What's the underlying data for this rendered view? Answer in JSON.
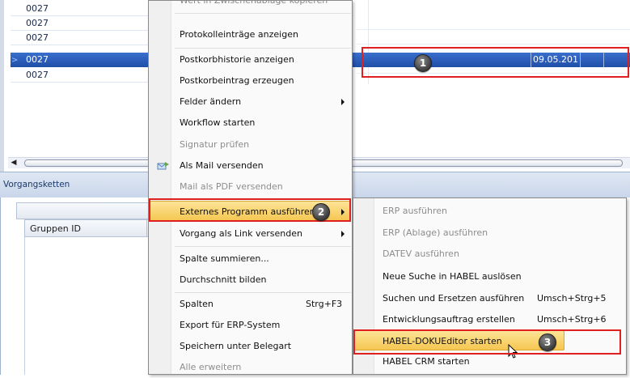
{
  "grid": {
    "rows": [
      {
        "id": "0027",
        "selected": false
      },
      {
        "id": "0027",
        "selected": false
      },
      {
        "id": "0027",
        "selected": false
      },
      {
        "id": "0027",
        "selected": true
      },
      {
        "id": "0027",
        "selected": false
      }
    ],
    "selected_date": "09.05.201",
    "scroll_left_arrow": "◀"
  },
  "panel": {
    "title": "Vorgangsketten",
    "column_header": "Gruppen ID"
  },
  "context_menu": {
    "items": [
      {
        "label": "Wert in Zwischenablage kopieren",
        "disabled": false
      },
      {
        "label": "Protokolleinträge anzeigen",
        "disabled": false
      },
      {
        "label": "Postkorbhistorie anzeigen",
        "disabled": false
      },
      {
        "label": "Postkorbeintrag erzeugen",
        "disabled": false
      },
      {
        "label": "Felder ändern",
        "disabled": false,
        "submenu": true
      },
      {
        "label": "Workflow starten",
        "disabled": false
      },
      {
        "label": "Signatur prüfen",
        "disabled": true
      },
      {
        "label": "Als Mail versenden",
        "disabled": false,
        "icon": "mail-icon"
      },
      {
        "label": "Mail als PDF versenden",
        "disabled": true
      },
      {
        "label": "Externes Programm ausführen",
        "disabled": false,
        "submenu": true,
        "highlighted": true
      },
      {
        "label": "Vorgang als Link versenden",
        "disabled": false,
        "submenu": true
      },
      {
        "label": "Spalte summieren...",
        "disabled": false
      },
      {
        "label": "Durchschnitt bilden",
        "disabled": false
      },
      {
        "label": "Spalten",
        "disabled": false,
        "shortcut": "Strg+F3"
      },
      {
        "label": "Export für ERP-System",
        "disabled": false
      },
      {
        "label": "Speichern unter Belegart",
        "disabled": false
      },
      {
        "label": "Alle erweitern",
        "disabled": true
      }
    ]
  },
  "submenu": {
    "items": [
      {
        "label": "ERP ausführen",
        "disabled": true
      },
      {
        "label": "ERP (Ablage) ausführen",
        "disabled": true
      },
      {
        "label": "DATEV ausführen",
        "disabled": true
      },
      {
        "label": "Neue Suche in HABEL auslösen",
        "disabled": false
      },
      {
        "label": "Suchen und Ersetzen ausführen",
        "disabled": false,
        "shortcut": "Umsch+Strg+5"
      },
      {
        "label": "Entwicklungsauftrag erstellen",
        "disabled": false,
        "shortcut": "Umsch+Strg+6"
      },
      {
        "label": "HABEL-DOKUEditor starten",
        "disabled": false,
        "highlighted": true
      },
      {
        "label": "HABEL CRM starten",
        "disabled": false
      }
    ]
  },
  "annotations": {
    "badge_1": "1",
    "badge_2": "2",
    "badge_3": "3",
    "highlight_color": "#e02020"
  }
}
